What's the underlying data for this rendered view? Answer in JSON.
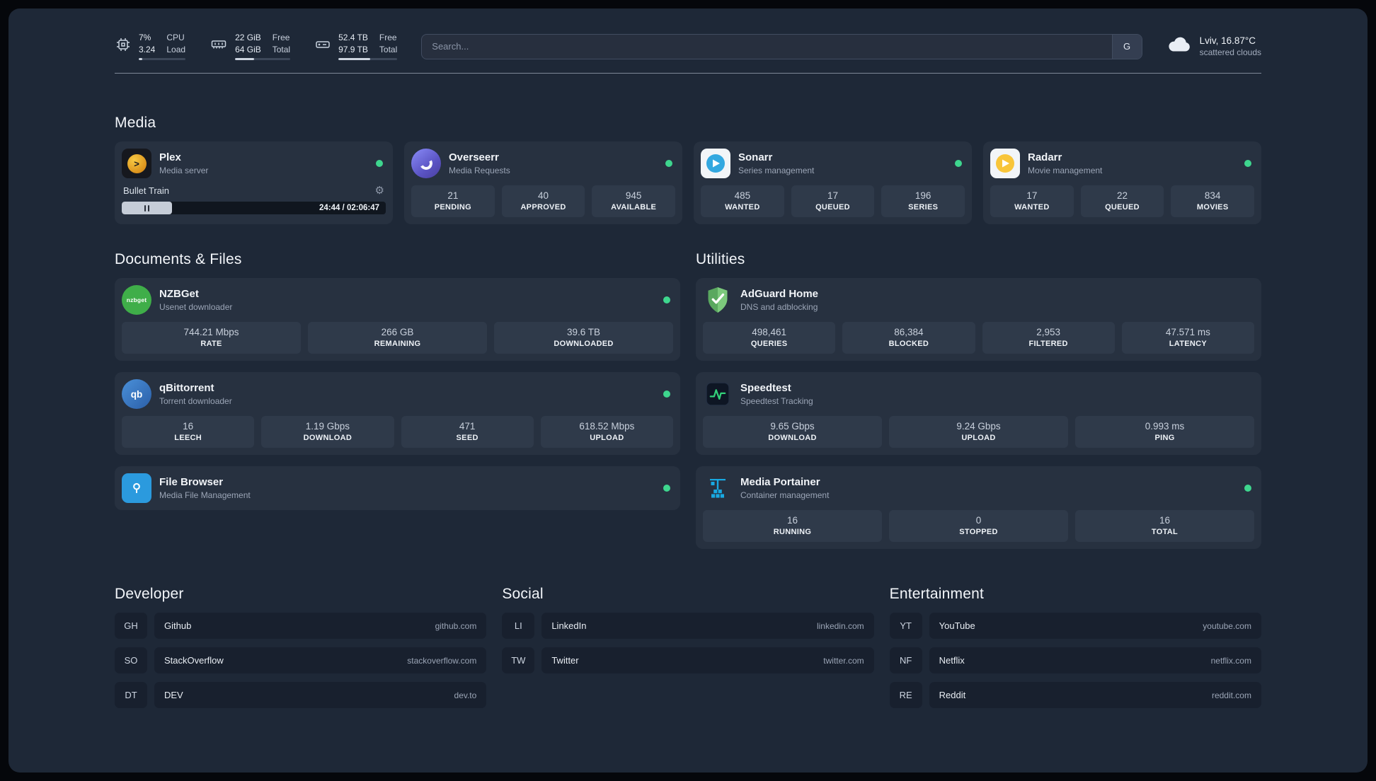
{
  "topbar": {
    "resources": [
      {
        "name": "cpu",
        "values": [
          "7%",
          "3.24"
        ],
        "labels": [
          "CPU",
          "Load"
        ],
        "percent": 7
      },
      {
        "name": "memory",
        "values": [
          "22 GiB",
          "64 GiB"
        ],
        "labels": [
          "Free",
          "Total"
        ],
        "percent": 34
      },
      {
        "name": "disk",
        "values": [
          "52.4 TB",
          "97.9 TB"
        ],
        "labels": [
          "Free",
          "Total"
        ],
        "percent": 54
      }
    ],
    "search": {
      "placeholder": "Search...",
      "provider_label": "G"
    },
    "weather": {
      "location": "Lviv, 16.87°C",
      "condition": "scattered clouds"
    }
  },
  "sections": {
    "media": {
      "title": "Media"
    },
    "documents": {
      "title": "Documents & Files"
    },
    "utilities": {
      "title": "Utilities"
    },
    "developer": {
      "title": "Developer"
    },
    "social": {
      "title": "Social"
    },
    "entertainment": {
      "title": "Entertainment"
    }
  },
  "media_cards": [
    {
      "name": "Plex",
      "description": "Media server",
      "status": "online",
      "player": {
        "title": "Bullet Train",
        "time": "24:44 / 02:06:47",
        "progress_percent": 19
      }
    },
    {
      "name": "Overseerr",
      "description": "Media Requests",
      "status": "online",
      "stats": [
        {
          "value": "21",
          "label": "PENDING"
        },
        {
          "value": "40",
          "label": "APPROVED"
        },
        {
          "value": "945",
          "label": "AVAILABLE"
        }
      ]
    },
    {
      "name": "Sonarr",
      "description": "Series management",
      "status": "online",
      "stats": [
        {
          "value": "485",
          "label": "WANTED"
        },
        {
          "value": "17",
          "label": "QUEUED"
        },
        {
          "value": "196",
          "label": "SERIES"
        }
      ]
    },
    {
      "name": "Radarr",
      "description": "Movie management",
      "status": "online",
      "stats": [
        {
          "value": "17",
          "label": "WANTED"
        },
        {
          "value": "22",
          "label": "QUEUED"
        },
        {
          "value": "834",
          "label": "MOVIES"
        }
      ]
    }
  ],
  "documents_cards": [
    {
      "name": "NZBGet",
      "description": "Usenet downloader",
      "status": "online",
      "stats": [
        {
          "value": "744.21 Mbps",
          "label": "RATE"
        },
        {
          "value": "266 GB",
          "label": "REMAINING"
        },
        {
          "value": "39.6 TB",
          "label": "DOWNLOADED"
        }
      ]
    },
    {
      "name": "qBittorrent",
      "description": "Torrent downloader",
      "status": "online",
      "stats": [
        {
          "value": "16",
          "label": "LEECH"
        },
        {
          "value": "1.19 Gbps",
          "label": "DOWNLOAD"
        },
        {
          "value": "471",
          "label": "SEED"
        },
        {
          "value": "618.52 Mbps",
          "label": "UPLOAD"
        }
      ]
    },
    {
      "name": "File Browser",
      "description": "Media File Management",
      "status": "online",
      "stats": []
    }
  ],
  "utilities_cards": [
    {
      "name": "AdGuard Home",
      "description": "DNS and adblocking",
      "status": "none",
      "stats": [
        {
          "value": "498,461",
          "label": "QUERIES"
        },
        {
          "value": "86,384",
          "label": "BLOCKED"
        },
        {
          "value": "2,953",
          "label": "FILTERED"
        },
        {
          "value": "47.571 ms",
          "label": "LATENCY"
        }
      ]
    },
    {
      "name": "Speedtest",
      "description": "Speedtest Tracking",
      "status": "none",
      "stats": [
        {
          "value": "9.65 Gbps",
          "label": "DOWNLOAD"
        },
        {
          "value": "9.24 Gbps",
          "label": "UPLOAD"
        },
        {
          "value": "0.993 ms",
          "label": "PING"
        }
      ]
    },
    {
      "name": "Media Portainer",
      "description": "Container management",
      "status": "online",
      "stats": [
        {
          "value": "16",
          "label": "RUNNING"
        },
        {
          "value": "0",
          "label": "STOPPED"
        },
        {
          "value": "16",
          "label": "TOTAL"
        }
      ]
    }
  ],
  "bookmarks": {
    "developer": [
      {
        "abbr": "GH",
        "name": "Github",
        "domain": "github.com"
      },
      {
        "abbr": "SO",
        "name": "StackOverflow",
        "domain": "stackoverflow.com"
      },
      {
        "abbr": "DT",
        "name": "DEV",
        "domain": "dev.to"
      }
    ],
    "social": [
      {
        "abbr": "LI",
        "name": "LinkedIn",
        "domain": "linkedin.com"
      },
      {
        "abbr": "TW",
        "name": "Twitter",
        "domain": "twitter.com"
      }
    ],
    "entertainment": [
      {
        "abbr": "YT",
        "name": "YouTube",
        "domain": "youtube.com"
      },
      {
        "abbr": "NF",
        "name": "Netflix",
        "domain": "netflix.com"
      },
      {
        "abbr": "RE",
        "name": "Reddit",
        "domain": "reddit.com"
      }
    ]
  },
  "colors": {
    "background": "#1e2837",
    "card": "#273140",
    "status_online": "#3ed68e",
    "plex_gold": "#e5a00d",
    "overseerr_purple": "#6366f1",
    "sonarr_blue": "#33a8e0",
    "radarr_yellow": "#f8c53a",
    "nzbget_green": "#3fae49",
    "qbittorrent_blue": "#2b5fa8",
    "filebrowser_blue": "#2b9ade",
    "adguard_green": "#63b663",
    "speedtest_green": "#33d17a",
    "portainer_blue": "#18a9e2"
  }
}
